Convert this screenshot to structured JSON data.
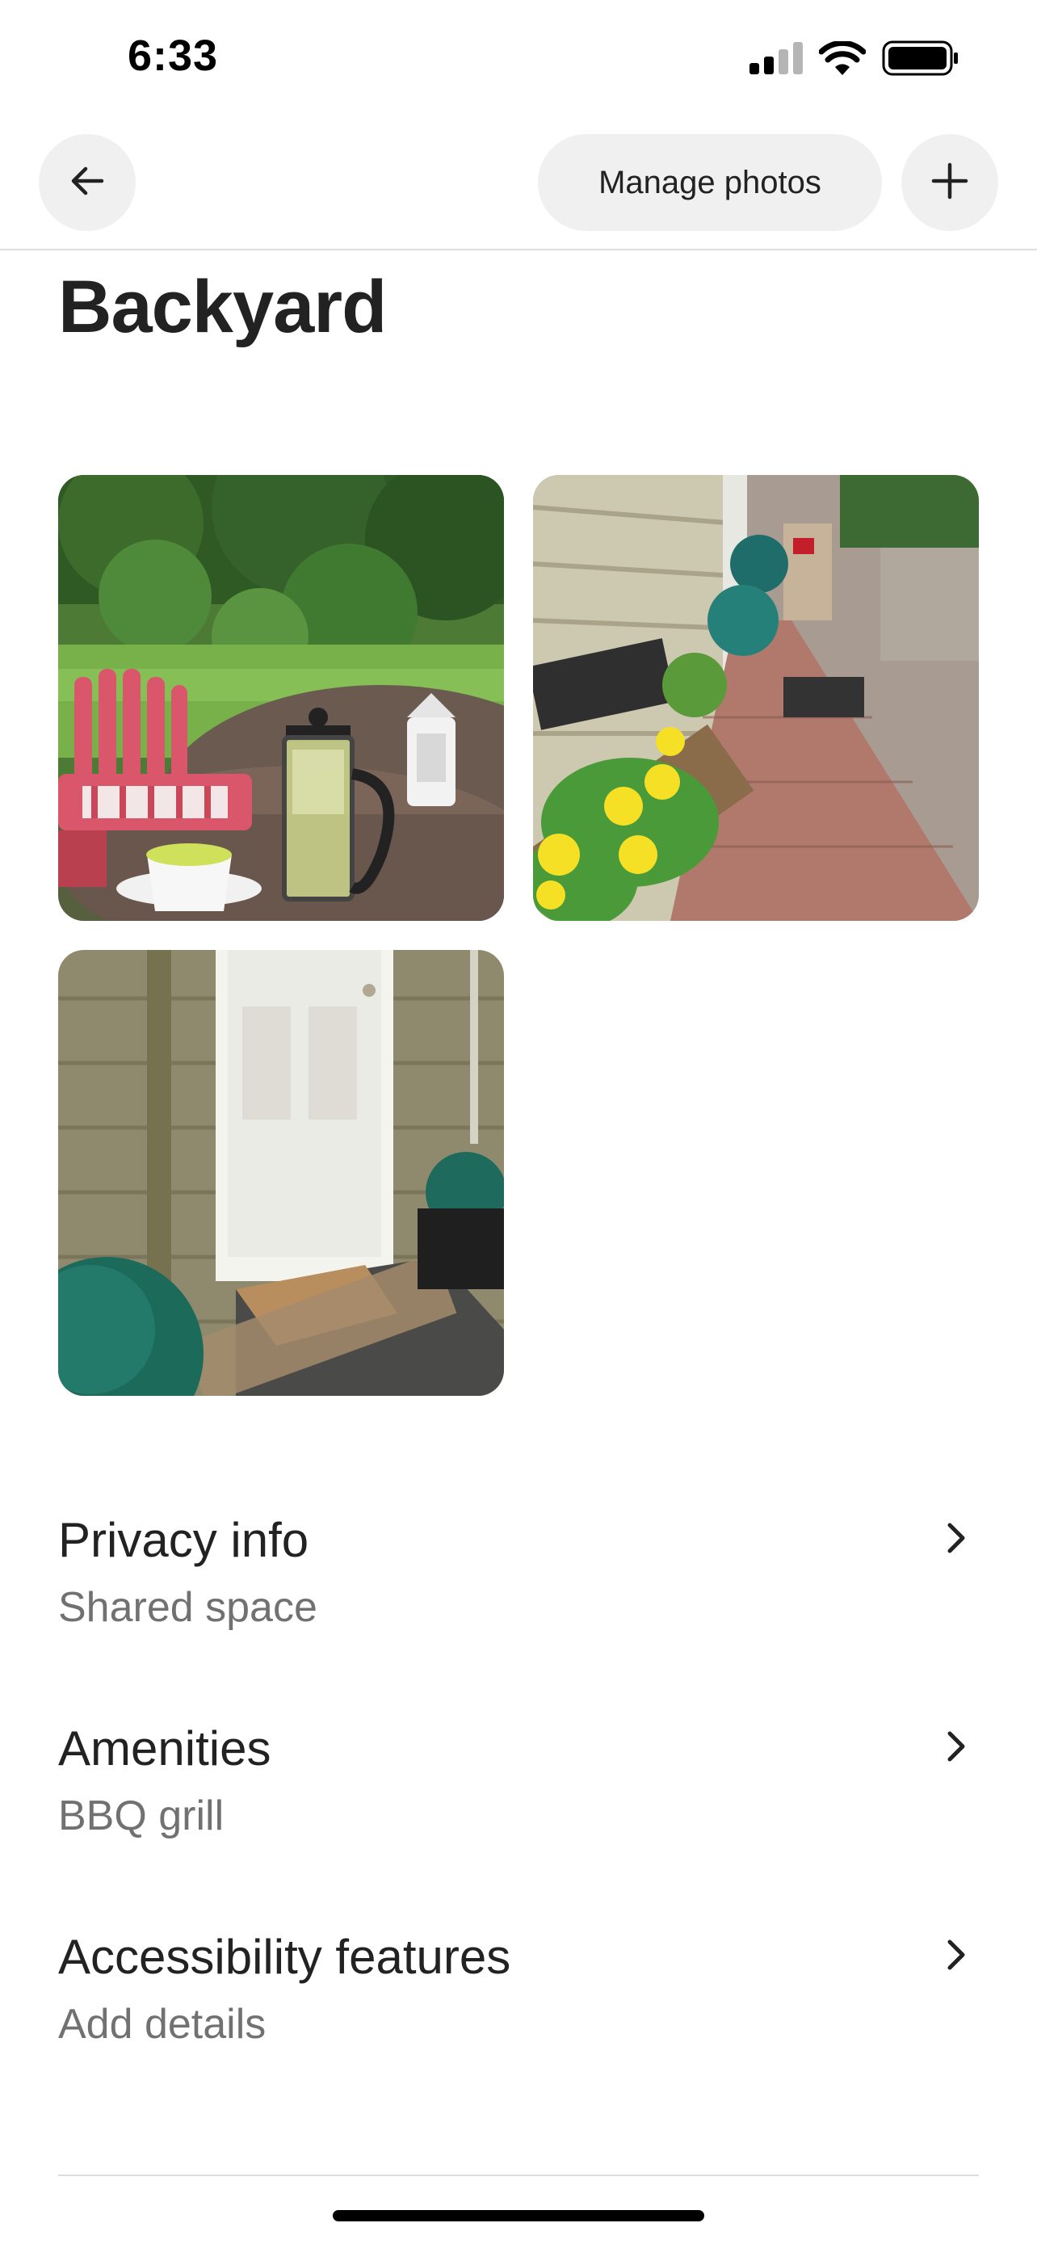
{
  "status_bar": {
    "time": "6:33",
    "icons": [
      "signal-icon",
      "wifi-icon",
      "battery-icon"
    ]
  },
  "nav": {
    "back_icon": "arrow-left-icon",
    "manage_photos_label": "Manage photos",
    "add_icon": "plus-icon"
  },
  "page": {
    "title": "Backyard"
  },
  "photos": [
    {
      "subject": "backyard patio with red adirondack chair, tea press and lantern"
    },
    {
      "subject": "side walkway with yellow flower planter"
    },
    {
      "subject": "white back door with doormat and topiary balls"
    }
  ],
  "rows": [
    {
      "title": "Privacy info",
      "subtitle": "Shared space",
      "icon": "chevron-right-icon"
    },
    {
      "title": "Amenities",
      "subtitle": "BBQ grill",
      "icon": "chevron-right-icon"
    },
    {
      "title": "Accessibility features",
      "subtitle": "Add details",
      "icon": "chevron-right-icon"
    }
  ],
  "colors": {
    "text_primary": "#222222",
    "text_secondary": "#717171",
    "button_bg": "#f0f0f0",
    "divider": "#dddddd"
  }
}
